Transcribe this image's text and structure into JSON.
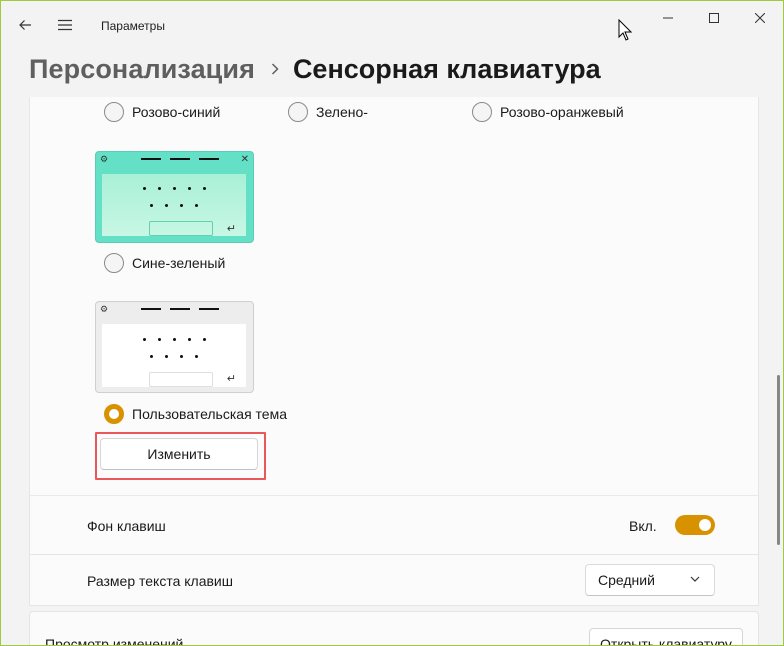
{
  "window": {
    "app_title": "Параметры",
    "accent_color": "#d89200",
    "border_color": "#9ccc3c"
  },
  "breadcrumb": {
    "parent": "Персонализация",
    "current": "Сенсорная клавиатура"
  },
  "themes": {
    "top_row": [
      {
        "label": "Розово-синий",
        "checked": false
      },
      {
        "label": "Зелено-",
        "checked": false
      },
      {
        "label": "Розово-оранжевый",
        "checked": false
      }
    ],
    "blue_green": {
      "label": "Сине-зеленый",
      "checked": false
    },
    "custom": {
      "label": "Пользовательская тема",
      "checked": true
    },
    "change_button": "Изменить",
    "preview_glyphs": {
      "gear": "⚙",
      "close": "✕",
      "enter": "↵"
    }
  },
  "key_background": {
    "label": "Фон клавиш",
    "state": "Вкл.",
    "on": true
  },
  "key_text_size": {
    "label": "Размер текста клавиш",
    "value": "Средний"
  },
  "preview": {
    "label": "Просмотр изменений",
    "button": "Открыть клавиатуру"
  }
}
